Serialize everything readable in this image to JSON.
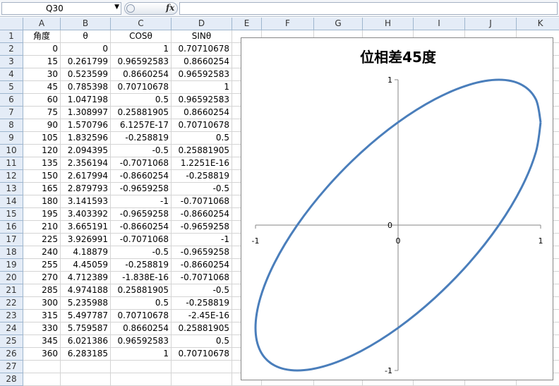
{
  "formula_bar": {
    "name_box": "Q30",
    "fx_label": "fx",
    "content": ""
  },
  "columns": [
    "A",
    "B",
    "C",
    "D",
    "E",
    "F",
    "G",
    "H",
    "I",
    "J",
    "K"
  ],
  "header_row": [
    "角度",
    "θ",
    "COSθ",
    "SINθ"
  ],
  "rows": [
    [
      "0",
      "0",
      "1",
      "0.70710678"
    ],
    [
      "15",
      "0.261799",
      "0.96592583",
      "0.8660254"
    ],
    [
      "30",
      "0.523599",
      "0.8660254",
      "0.96592583"
    ],
    [
      "45",
      "0.785398",
      "0.70710678",
      "1"
    ],
    [
      "60",
      "1.047198",
      "0.5",
      "0.96592583"
    ],
    [
      "75",
      "1.308997",
      "0.25881905",
      "0.8660254"
    ],
    [
      "90",
      "1.570796",
      "6.1257E-17",
      "0.70710678"
    ],
    [
      "105",
      "1.832596",
      "-0.258819",
      "0.5"
    ],
    [
      "120",
      "2.094395",
      "-0.5",
      "0.25881905"
    ],
    [
      "135",
      "2.356194",
      "-0.7071068",
      "1.2251E-16"
    ],
    [
      "150",
      "2.617994",
      "-0.8660254",
      "-0.258819"
    ],
    [
      "165",
      "2.879793",
      "-0.9659258",
      "-0.5"
    ],
    [
      "180",
      "3.141593",
      "-1",
      "-0.7071068"
    ],
    [
      "195",
      "3.403392",
      "-0.9659258",
      "-0.8660254"
    ],
    [
      "210",
      "3.665191",
      "-0.8660254",
      "-0.9659258"
    ],
    [
      "225",
      "3.926991",
      "-0.7071068",
      "-1"
    ],
    [
      "240",
      "4.18879",
      "-0.5",
      "-0.9659258"
    ],
    [
      "255",
      "4.45059",
      "-0.258819",
      "-0.8660254"
    ],
    [
      "270",
      "4.712389",
      "-1.838E-16",
      "-0.7071068"
    ],
    [
      "285",
      "4.974188",
      "0.25881905",
      "-0.5"
    ],
    [
      "300",
      "5.235988",
      "0.5",
      "-0.258819"
    ],
    [
      "315",
      "5.497787",
      "0.70710678",
      "-2.45E-16"
    ],
    [
      "330",
      "5.759587",
      "0.8660254",
      "0.25881905"
    ],
    [
      "345",
      "6.021386",
      "0.96592583",
      "0.5"
    ],
    [
      "360",
      "6.283185",
      "1",
      "0.70710678"
    ]
  ],
  "row_numbers": [
    "1",
    "2",
    "3",
    "4",
    "5",
    "6",
    "7",
    "8",
    "9",
    "10",
    "11",
    "12",
    "13",
    "14",
    "15",
    "16",
    "17",
    "18",
    "19",
    "20",
    "21",
    "22",
    "23",
    "24",
    "25",
    "26",
    "27",
    "28"
  ],
  "chart_data": {
    "type": "scatter",
    "title": "位相差45度",
    "xlim": [
      -1,
      1
    ],
    "ylim": [
      -1,
      1
    ],
    "x_ticks": [
      "-1",
      "0",
      "1"
    ],
    "y_ticks": [
      "1",
      "0",
      "-1"
    ],
    "line_color": "#4a7ebb",
    "series": [
      {
        "x": [
          1,
          0.96592583,
          0.8660254,
          0.70710678,
          0.5,
          0.25881905,
          0,
          -0.258819,
          -0.5,
          -0.7071068,
          -0.8660254,
          -0.9659258,
          -1,
          -0.9659258,
          -0.8660254,
          -0.7071068,
          -0.5,
          -0.258819,
          0,
          0.25881905,
          0.5,
          0.70710678,
          0.8660254,
          0.96592583,
          1
        ],
        "y": [
          0.70710678,
          0.8660254,
          0.96592583,
          1,
          0.96592583,
          0.8660254,
          0.70710678,
          0.5,
          0.25881905,
          0,
          -0.258819,
          -0.5,
          -0.7071068,
          -0.8660254,
          -0.9659258,
          -1,
          -0.9659258,
          -0.8660254,
          -0.7071068,
          -0.5,
          -0.258819,
          0,
          0.25881905,
          0.5,
          0.70710678
        ]
      }
    ]
  }
}
